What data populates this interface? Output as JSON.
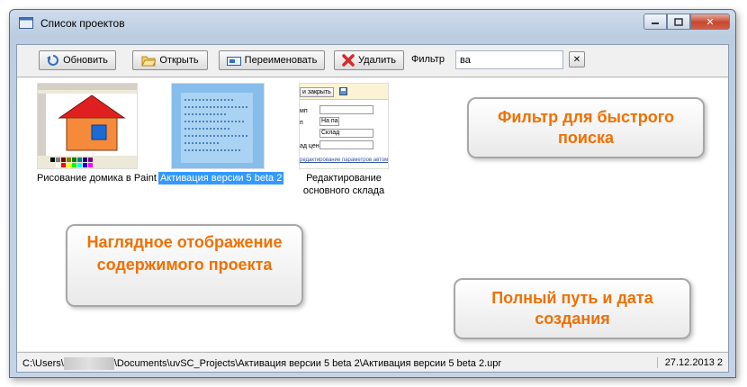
{
  "window": {
    "title": "Список проектов"
  },
  "toolbar": {
    "refresh_label": "Обновить",
    "open_label": "Открыть",
    "rename_label": "Переименовать",
    "delete_label": "Удалить",
    "filter_label": "Фильтр",
    "filter_value": "ва"
  },
  "projects": [
    {
      "caption": "Рисование домика в Paint"
    },
    {
      "caption": "Активация версии 5 beta 2",
      "selected": true
    },
    {
      "caption": "Редактирование основного склада"
    }
  ],
  "thumb3": {
    "button": "и закрыть",
    "rows": [
      "мп",
      "п",
      "",
      "ад цен"
    ],
    "fields": [
      "",
      "На па",
      "Склад",
      ""
    ],
    "footer": "редактирование параметров автом"
  },
  "status": {
    "path_start": "C:\\Users\\",
    "path_end": "\\Documents\\uvSC_Projects\\Активация версии 5 beta 2\\Активация версии 5 beta 2.upr",
    "date": "27.12.2013 2"
  },
  "callouts": {
    "filter": "Фильтр для быстрого поиска",
    "display": "Наглядное отображение содержимого проекта",
    "path": "Полный путь и дата создания"
  },
  "colors": {
    "callout_text": "#f07000",
    "selection": "#3399ff"
  }
}
